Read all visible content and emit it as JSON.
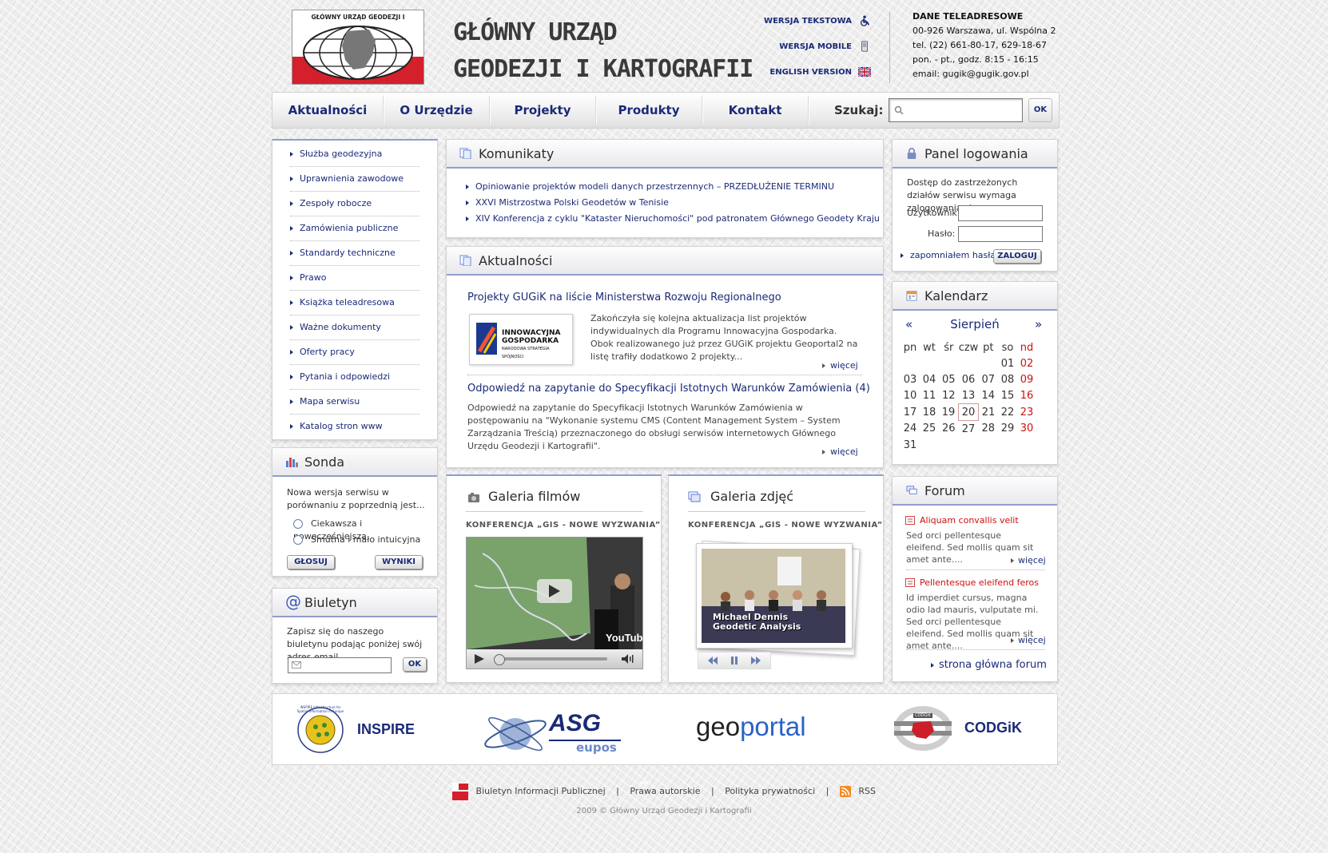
{
  "header": {
    "logo_caption": "GŁÓWNY URZĄD GEODEZJI I KARTOGRAFII",
    "title_line1": "GŁÓWNY URZĄD",
    "title_line2": "GEODEZJI I KARTOGRAFII",
    "text_version": "WERSJA TEKSTOWA",
    "mobile_version": "WERSJA MOBILE",
    "english_version": "ENGLISH VERSION",
    "contact": {
      "heading": "DANE TELEADRESOWE",
      "address": "00-926 Warszawa, ul. Wspólna 2",
      "phone": "tel. (22) 661-80-17, 629-18-67",
      "hours": "pon. - pt., godz. 8:15 - 16:15",
      "email": "email: gugik@gugik.gov.pl"
    }
  },
  "nav": {
    "items": [
      "Aktualności",
      "O Urzędzie",
      "Projekty",
      "Produkty",
      "Kontakt"
    ],
    "search_label": "Szukaj:",
    "search_placeholder": "",
    "search_button": "OK"
  },
  "leftnav": {
    "items": [
      "Służba geodezyjna",
      "Uprawnienia zawodowe",
      "Zespoły robocze",
      "Zamówienia publiczne",
      "Standardy techniczne",
      "Prawo",
      "Książka teleadresowa",
      "Ważne dokumenty",
      "Oferty pracy",
      "Pytania i odpowiedzi",
      "Mapa serwisu",
      "Katalog stron www"
    ]
  },
  "sonda": {
    "title": "Sonda",
    "question": "Nowa wersja serwisu w porównaniu z poprzednią jest...",
    "options": [
      "Ciekawsza i nowocześniejsza",
      "Smutna i mało intuicyjna"
    ],
    "vote_button": "GŁOSUJ",
    "results_button": "WYNIKI"
  },
  "newsletter": {
    "title": "Biuletyn",
    "text": "Zapisz się do naszego biuletynu podając poniżej swój adres email.",
    "email_placeholder": "",
    "button": "OK"
  },
  "komunikaty": {
    "title": "Komunikaty",
    "items": [
      "Opiniowanie projektów modeli danych przestrzennych – PRZEDŁUŻENIE TERMINU",
      "XXVI Mistrzostwa Polski Geodetów w Tenisie",
      "XIV Konferencja z cyklu \"Kataster Nieruchomości\" pod patronatem Głównego Geodety Kraju"
    ]
  },
  "aktualnosci": {
    "title": "Aktualności",
    "news": [
      {
        "title": "Projekty GUGiK na liście Ministerstwa Rozwoju Regionalnego",
        "text": "Zakończyła się kolejna aktualizacja list projektów indywidualnych dla Programu Innowacyjna Gospodarka. Obok realizowanego już przez GUGiK projektu Geoportal2  na listę trafiły dodatkowo 2 projekty...",
        "more": "więcej",
        "image_text1": "INNOWACYJNA",
        "image_text2": "GOSPODARKA",
        "image_text3": "NARODOWA STRATEGIA SPÓJNOŚCI"
      },
      {
        "title": "Odpowiedź na zapytanie do Specyfikacji Istotnych Warunków Zamówienia (4)",
        "text": "Odpowiedź na zapytanie do Specyfikacji Istotnych Warunków Zamówienia w postępowaniu na \"Wykonanie systemu CMS (Content Management System – System Zarządzania Treścią) przeznaczonego do obsługi serwisów internetowych Głównego Urzędu Geodezji i Kartografii\".",
        "more": "więcej"
      }
    ]
  },
  "films": {
    "title": "Galeria filmów",
    "caption": "KONFERENCJA „GIS - NOWE WYZWANIA”",
    "youtube": "YouTube"
  },
  "photos": {
    "title": "Galeria zdjęć",
    "caption": "KONFERENCJA „GIS - NOWE WYZWANIA”",
    "photo_caption1": "Michael Dennis",
    "photo_caption2": "Geodetic Analysis"
  },
  "login": {
    "title": "Panel logowania",
    "text": "Dostęp do zastrzeżonych działów serwisu wymaga zalogowania się.",
    "user_label": "Użytkownik:",
    "pass_label": "Hasło:",
    "forgot": "zapomniałem hasła",
    "button": "ZALOGUJ"
  },
  "calendar": {
    "title": "Kalendarz",
    "month": "Sierpień",
    "prev": "«",
    "next": "»",
    "days": [
      "pn",
      "wt",
      "śr",
      "czw",
      "pt",
      "so",
      "nd"
    ],
    "weeks": [
      [
        "",
        "",
        "",
        "",
        "",
        "01",
        "02"
      ],
      [
        "03",
        "04",
        "05",
        "06",
        "07",
        "08",
        "09"
      ],
      [
        "10",
        "11",
        "12",
        "13",
        "14",
        "15",
        "16"
      ],
      [
        "17",
        "18",
        "19",
        "20",
        "21",
        "22",
        "23"
      ],
      [
        "24",
        "25",
        "26",
        "27",
        "28",
        "29",
        "30"
      ],
      [
        "31",
        "",
        "",
        "",
        "",
        "",
        ""
      ]
    ],
    "today": "20"
  },
  "forum": {
    "title": "Forum",
    "posts": [
      {
        "title": "Aliquam convallis velit",
        "text": "Sed orci pellentesque eleifend. Sed mollis quam sit amet ante....",
        "more": "więcej"
      },
      {
        "title": "Pellentesque eleifend feros",
        "text": "Id imperdiet cursus, magna odio lad mauris, vulputate mi. Sed orci pellentesque eleifend.  Sed mollis quam sit amet ante....",
        "more": "więcej"
      }
    ],
    "home_link": "strona główna forum"
  },
  "partners": {
    "inspire": "INSPIRE",
    "inspire_ring": "INSPIRE Infrastructure for Spatial Information in Europe",
    "asg": "ASG",
    "asg_sub": "eupos",
    "geoportal_geo": "geo",
    "geoportal_portal": "portal",
    "codgik": "CODGiK",
    "codgik_badge": "CODGiK"
  },
  "footer": {
    "bip_badge": "bip",
    "links": [
      "Biuletyn Informacji Publicznej",
      "Prawa autorskie",
      "Polityka prywatności",
      "RSS"
    ],
    "copyright": "2009 © Główny Urząd Geodezji i Kartografii"
  },
  "colors": {
    "accent": "#1a2a78",
    "red": "#cc1111",
    "header_line": "#8e9fc8"
  }
}
